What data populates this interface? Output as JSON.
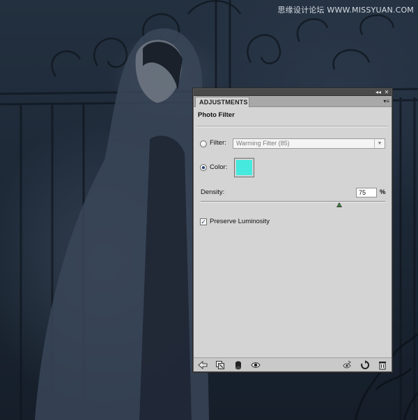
{
  "watermark": "思缘设计论坛 WWW.MISSYUAN.COM",
  "panel": {
    "title_controls": {
      "collapse": "◂◂",
      "close": "✕"
    },
    "tab_label": "ADJUSTMENTS",
    "menu_icon": "▾≡",
    "section_title": "Photo Filter",
    "filter": {
      "label": "Filter:",
      "selected": false,
      "value": "Warming Filter (85)",
      "arrow": "▼"
    },
    "color": {
      "label": "Color:",
      "selected": true,
      "swatch": "#45e9dd"
    },
    "density": {
      "label": "Density:",
      "value": "75",
      "unit": "%",
      "slider_percent": 75
    },
    "preserve_luminosity": {
      "label": "Preserve Luminosity",
      "checked": true,
      "mark": "✓"
    }
  },
  "bottom_icons": [
    "back-arrow-icon",
    "clip-layer-icon",
    "layer-mask-icon",
    "visibility-eye-icon",
    "view-previous-state-icon",
    "reset-icon",
    "delete-trash-icon"
  ],
  "colors": {
    "panel_bg": "#d4d4d4",
    "titlebar": "#4a4a4a",
    "swatch": "#45e9dd",
    "background_photo": "#1c2735"
  }
}
